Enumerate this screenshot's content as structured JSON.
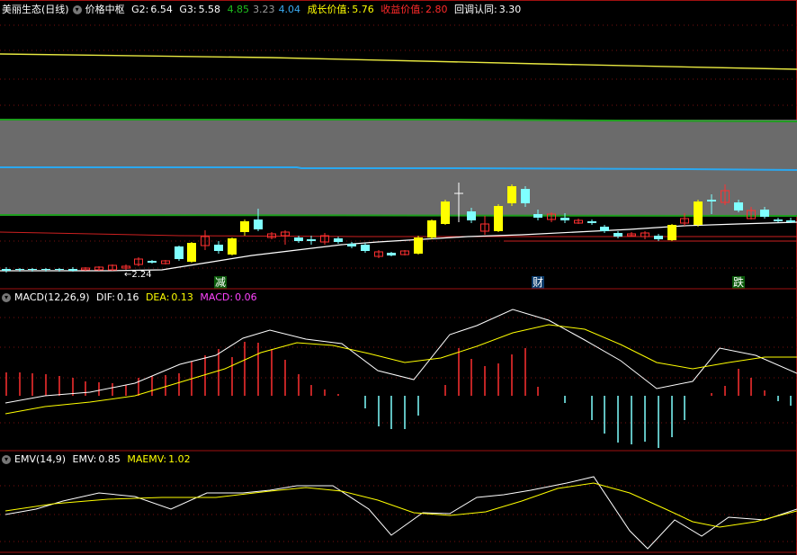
{
  "main": {
    "stock_title": "美丽生态(日线)",
    "indicator_name": "价格中枢",
    "g2_label": "G2:",
    "g2_value": "6.54",
    "g3_label": "G3:",
    "g3_value": "5.58",
    "v1": "4.85",
    "v2": "3.23",
    "v3": "4.04",
    "growth_label": "成长价值:",
    "growth_value": "5.76",
    "income_label": "收益价值:",
    "income_value": "2.80",
    "pullback_label": "回调认同:",
    "pullback_value": "3.30",
    "low_marker": "2.24",
    "signals": [
      "减",
      "财",
      "跌"
    ],
    "colors": {
      "band": "#6b6b6b",
      "green": "#1e9e1e",
      "blue": "#1e9ee0",
      "red": "#ff2a2a",
      "yellow": "#ffff00",
      "cyan": "#7fffff"
    }
  },
  "macd": {
    "name": "MACD(12,26,9)",
    "dif_label": "DIF:",
    "dif_value": "0.16",
    "dea_label": "DEA:",
    "dea_value": "0.13",
    "macd_label": "MACD:",
    "macd_value": "0.06"
  },
  "emv": {
    "name": "EMV(14,9)",
    "emv_label": "EMV:",
    "emv_value": "0.85",
    "maemv_label": "MAEMV:",
    "maemv_value": "1.02"
  }
}
